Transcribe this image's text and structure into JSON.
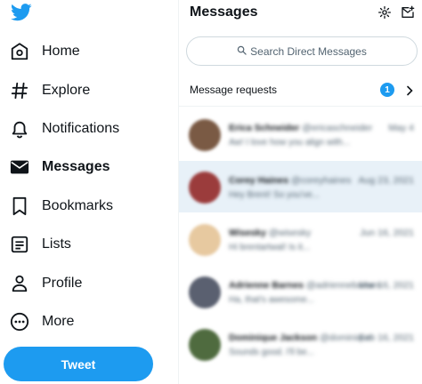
{
  "sidebar": {
    "logo_icon": "twitter-bird-icon",
    "items": [
      {
        "label": "Home",
        "icon": "home-icon"
      },
      {
        "label": "Explore",
        "icon": "hashtag-icon"
      },
      {
        "label": "Notifications",
        "icon": "bell-icon"
      },
      {
        "label": "Messages",
        "icon": "envelope-icon",
        "active": true
      },
      {
        "label": "Bookmarks",
        "icon": "bookmark-icon"
      },
      {
        "label": "Lists",
        "icon": "list-icon"
      },
      {
        "label": "Profile",
        "icon": "person-icon"
      },
      {
        "label": "More",
        "icon": "more-circle-icon"
      }
    ],
    "tweet_label": "Tweet"
  },
  "messages": {
    "title": "Messages",
    "settings_icon": "gear-icon",
    "new_message_icon": "compose-mail-icon",
    "search_placeholder": "Search Direct Messages",
    "requests_label": "Message requests",
    "requests_count": "1",
    "conversations": [
      {
        "name": "Erica Schneider",
        "handle": "@ericaschneider",
        "date": "May 4",
        "preview": "Aw! I love how you align with...",
        "avatar_color": "#7a5a44",
        "selected": false
      },
      {
        "name": "Corey Haines",
        "handle": "@coreyhaines",
        "date": "Aug 23, 2021",
        "preview": "Hey Brent! So you've...",
        "avatar_color": "#9b3c3c",
        "selected": true
      },
      {
        "name": "Wisesky",
        "handle": "@wisesky",
        "date": "Jun 16, 2021",
        "preview": "Hi brentartwal! Is it...",
        "avatar_color": "#e7c9a0",
        "selected": false
      },
      {
        "name": "Adrienne Barnes",
        "handle": "@adriennebarnes",
        "date": "Mar 16, 2021",
        "preview": "Ha, that's awesome...",
        "avatar_color": "#5a6070",
        "selected": false
      },
      {
        "name": "Dominique Jackson",
        "handle": "@dominique",
        "date": "Feb 16, 2021",
        "preview": "Sounds good. I'll be...",
        "avatar_color": "#4f6b3f",
        "selected": false
      }
    ]
  },
  "colors": {
    "accent": "#1d9bf0",
    "selected_row": "#e8f1f8",
    "text": "#0f1419",
    "muted": "#536471"
  }
}
